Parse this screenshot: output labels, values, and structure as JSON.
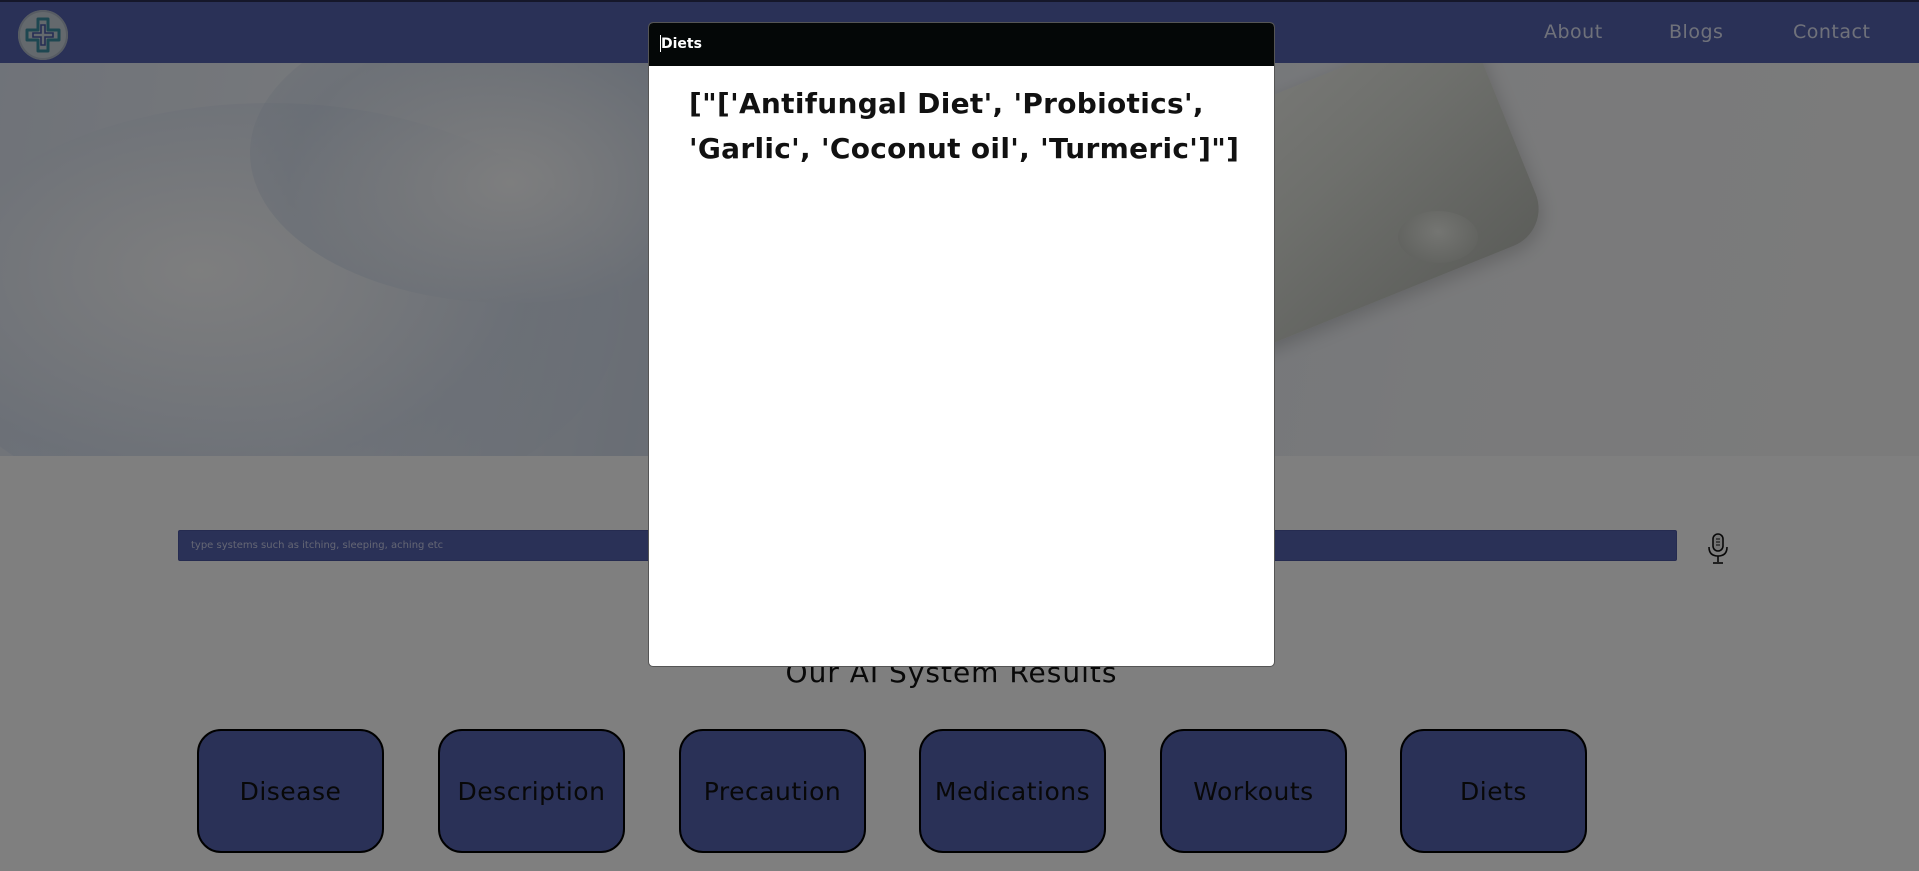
{
  "navbar": {
    "links": [
      "About",
      "Blogs",
      "Contact"
    ],
    "bg_color": "#5562ae"
  },
  "search": {
    "placeholder": "type systems such as itching, sleeping, aching etc",
    "value": ""
  },
  "results": {
    "title": "Our AI System Results",
    "buttons": [
      "Disease",
      "Description",
      "Precaution",
      "Medications",
      "Workouts",
      "Diets"
    ]
  },
  "modal": {
    "title": "Diets",
    "body": "[\"['Antifungal Diet', 'Probiotics', 'Garlic', 'Coconut oil', 'Turmeric']\"]"
  },
  "icons": {
    "logo": "medical-cross-logo",
    "mic": "microphone-icon"
  },
  "colors": {
    "accent": "#5562ae",
    "modal_header": "#040707",
    "overlay": "rgba(0,0,0,0.5)"
  }
}
